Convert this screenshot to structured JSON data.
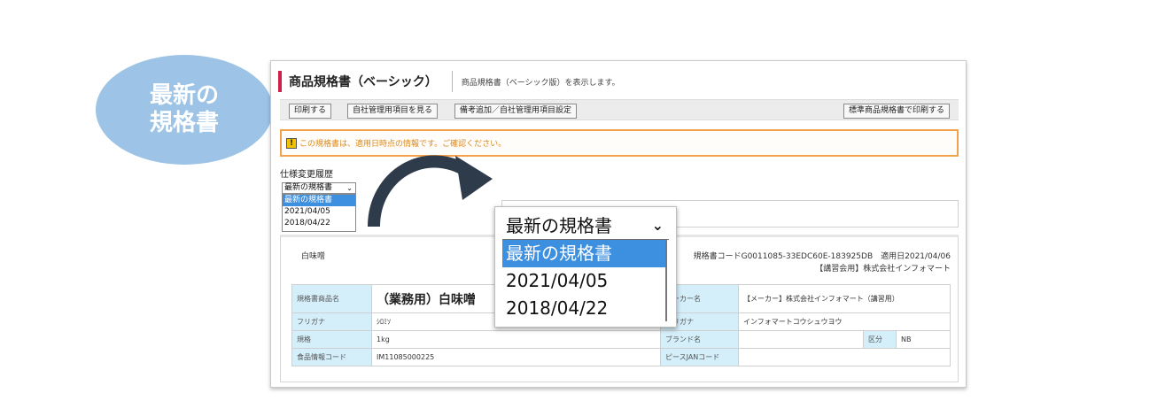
{
  "badge": {
    "line1": "最新の",
    "line2": "規格書"
  },
  "header": {
    "title": "商品規格書（ベーシック）",
    "description": "商品規格書（ベーシック版）を表示します。"
  },
  "toolbar": {
    "print": "印刷する",
    "view_company_items": "自社管理用項目を見る",
    "notes_settings": "備考追加／自社管理用項目設定",
    "standard_print": "標準商品規格書で印刷する"
  },
  "notice": {
    "icon": "!",
    "message": "この規格書は、適用日時点の情報です。ご確認ください。"
  },
  "history": {
    "label": "仕様変更履歴",
    "selected": "最新の規格書",
    "options": [
      "最新の規格書",
      "2021/04/05",
      "2018/04/22"
    ]
  },
  "product": {
    "name_small": "白味噌",
    "code_line": "規格書コードG0011085-33EDC60E-183925DB　適用日2021/04/06",
    "company_line": "【講習会用】株式会社インフォマート",
    "table": {
      "name_label": "規格書商品名",
      "name_value": "（業務用）白味噌",
      "maker_label": "メーカー名",
      "maker_value": "【メーカー】株式会社インフォマート（講習用）",
      "furigana_label": "フリガナ",
      "furigana_value": "ｼﾛﾐｿ",
      "maker_furigana_label": "フリガナ",
      "maker_furigana_value": "インフォマートコウシュウヨウ",
      "spec_label": "規格",
      "spec_value": "1kg",
      "brand_label": "ブランド名",
      "brand_value": "",
      "category_label": "区分",
      "category_value": "NB",
      "food_code_label": "食品情報コード",
      "food_code_value": "IM11085000225",
      "jan_label": "ピースJANコード",
      "jan_value": ""
    }
  },
  "colors": {
    "badge": "#9dc3e6",
    "accent": "#d0204a",
    "notice_border": "#f0a34a",
    "selected": "#3d8fe0",
    "table_header": "#d4eefa",
    "arrow": "#2e3b4b"
  }
}
